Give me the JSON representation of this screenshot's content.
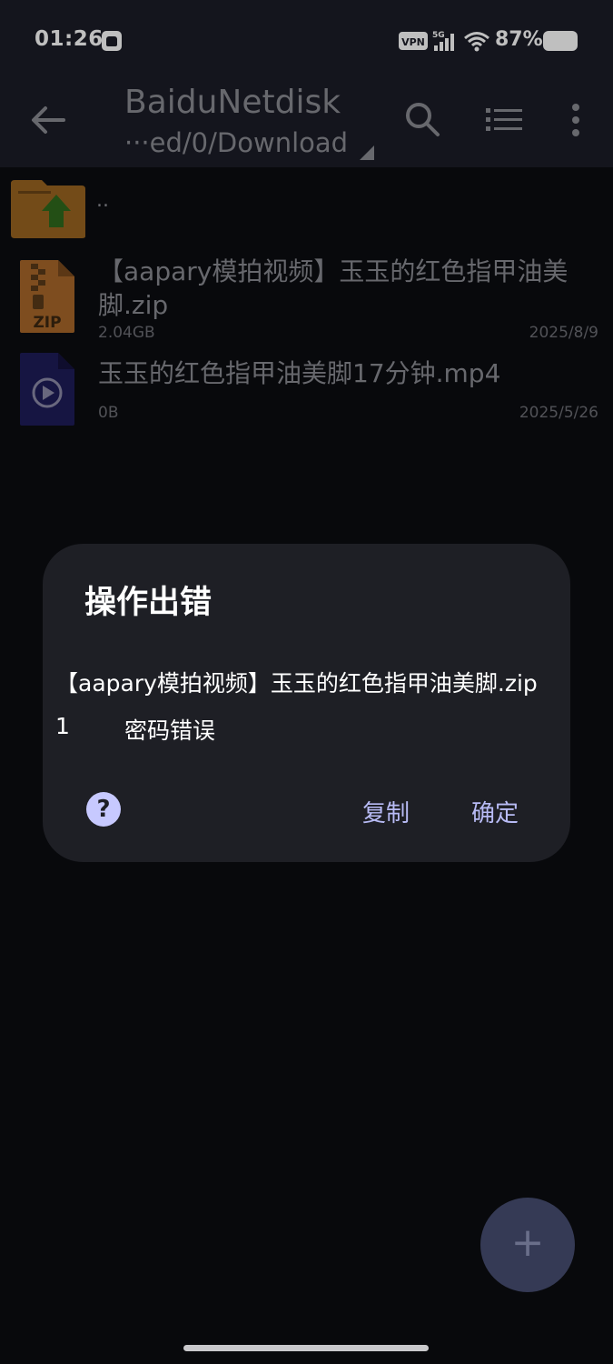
{
  "status": {
    "time": "01:26",
    "vpn": "VPN",
    "network": "5G",
    "battery": "87%"
  },
  "appbar": {
    "title": "BaiduNetdisk",
    "path": "···ed/0/Download"
  },
  "up_entry": {
    "label": ".."
  },
  "files": [
    {
      "name": "【aapary模拍视频】玉玉的红色指甲油美脚.zip",
      "size": "2.04GB",
      "date": "2025/8/9",
      "icon": "zip-icon",
      "badge": "ZIP"
    },
    {
      "name": "玉玉的红色指甲油美脚17分钟.mp4",
      "size": "0B",
      "date": "2025/5/26",
      "icon": "video-icon"
    }
  ],
  "dialog": {
    "title": "操作出错",
    "message": "【aapary模拍视频】玉玉的红色指甲油美脚.zip",
    "code": "1",
    "error": "密码错误",
    "help": "?",
    "copy_label": "复制",
    "ok_label": "确定"
  },
  "fab": {
    "label": "+"
  }
}
